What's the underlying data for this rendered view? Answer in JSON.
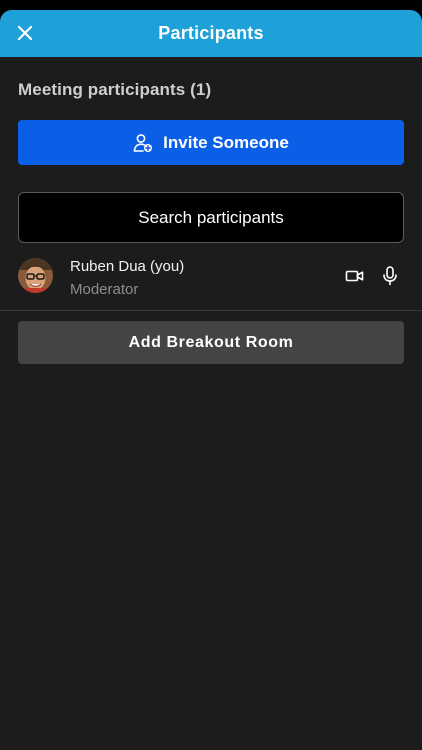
{
  "header": {
    "title": "Participants",
    "close_icon": "close-icon"
  },
  "section": {
    "heading": "Meeting participants (1)"
  },
  "invite": {
    "label": "Invite Someone",
    "icon": "add-person-icon"
  },
  "search": {
    "placeholder": "Search participants",
    "value": ""
  },
  "participants": [
    {
      "name": "Ruben Dua (you)",
      "role": "Moderator",
      "icons": [
        "video-camera-icon",
        "microphone-icon"
      ]
    }
  ],
  "breakout": {
    "label": "Add Breakout Room"
  },
  "colors": {
    "header_bg": "#1da1d8",
    "invite_bg": "#0a5fe6",
    "sheet_bg": "#1c1c1c",
    "breakout_bg": "#444444"
  }
}
